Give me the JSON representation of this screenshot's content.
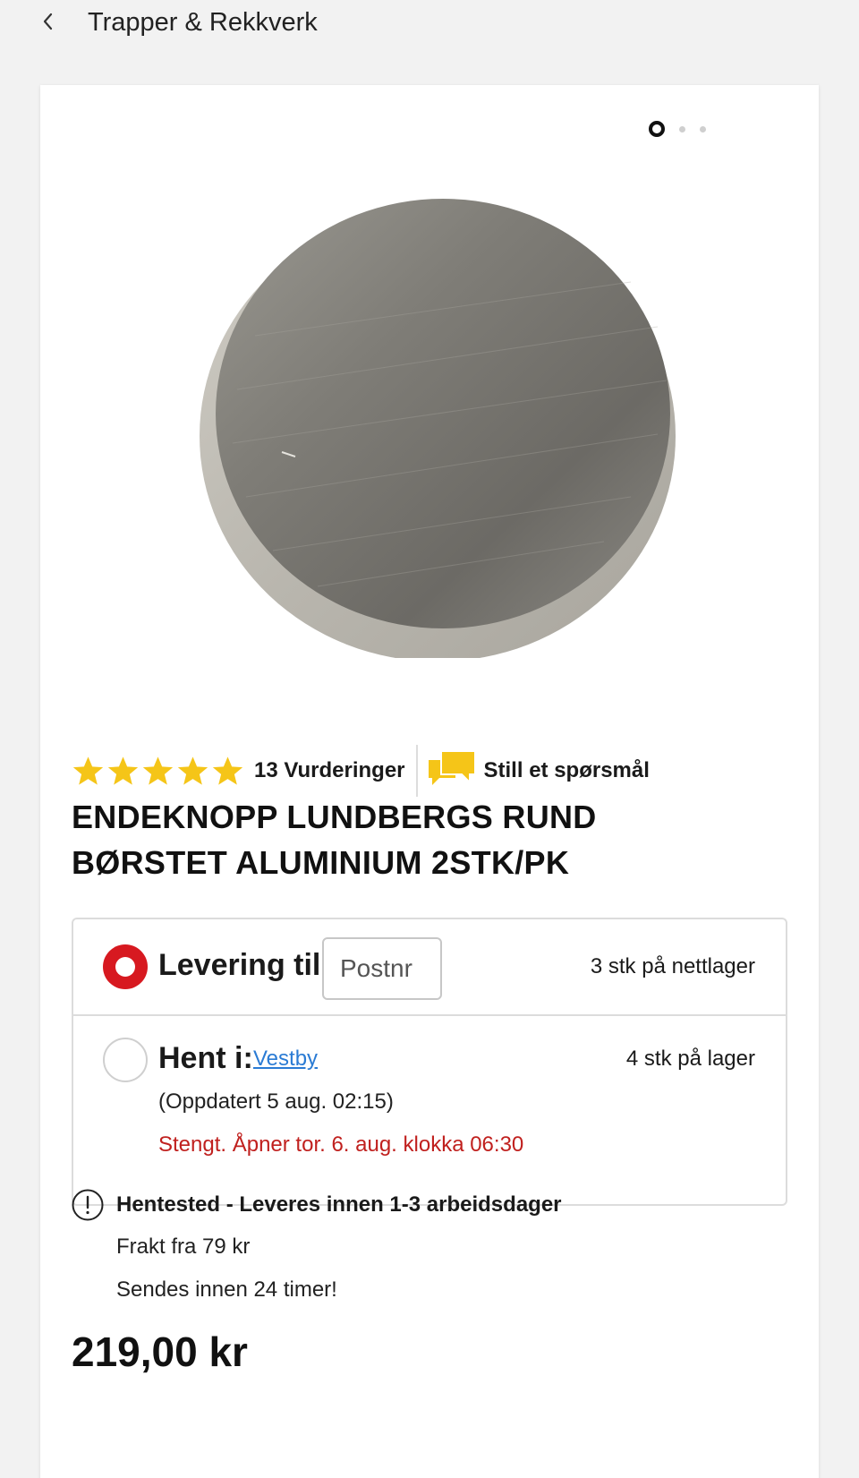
{
  "header": {
    "back_icon": "chevron-left-icon",
    "breadcrumb": "Trapper & Rekkverk"
  },
  "gallery": {
    "image_count": 3,
    "active_index": 0,
    "image_alt": "Endeknopp rund børstet aluminium"
  },
  "rating": {
    "stars": 5,
    "count_label": "13 Vurderinger",
    "star_color": "#f5c518",
    "question_icon": "speech-bubbles-icon",
    "question_label": "Still et spørsmål"
  },
  "product": {
    "title": "ENDEKNOPP LUNDBERGS RUND BØRSTET ALUMINIUM 2STK/PK",
    "price": "219,00 kr"
  },
  "delivery": {
    "home": {
      "label": "Levering til:",
      "placeholder": "Postnr",
      "stock": "3 stk på nettlager",
      "selected": true
    },
    "pickup": {
      "label": "Hent i:",
      "store": "Vestby",
      "stock": "4 stk på lager",
      "updated": "(Oppdatert 5 aug. 02:15)",
      "status": "Stengt. Åpner tor. 6. aug. klokka 06:30",
      "selected": false
    },
    "accent_color": "#d71920"
  },
  "shipping": {
    "icon": "exclamation-circle-icon",
    "heading": "Hentested - Leveres innen 1-3 arbeidsdager",
    "freight": "Frakt fra 79 kr",
    "dispatch": "Sendes innen 24 timer!"
  }
}
